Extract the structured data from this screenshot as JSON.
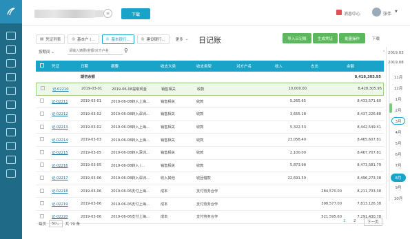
{
  "topbar": {
    "company_dropdown_placeholder": "",
    "top_action_label": "下载",
    "messages_label": "消息中心",
    "user_name": "张伟"
  },
  "tabs": [
    {
      "label": "凭证列表",
      "icon": "doc-icon"
    },
    {
      "label": "基本户 (..."
    },
    {
      "label": "基本银行..."
    },
    {
      "label": "建设银行..."
    },
    {
      "label": "更多"
    }
  ],
  "page": {
    "title": "日记账",
    "buttons": {
      "import": "导入日记账",
      "generate": "生成凭证",
      "more": "批量操作",
      "download": "下载"
    }
  },
  "filter": {
    "period_label": "按期间",
    "search_placeholder": "请输入摘要/金额/对方户名"
  },
  "table": {
    "headers": [
      "凭证",
      "日期",
      "摘要",
      "收支大类",
      "收支类型",
      "对方户名",
      "收入",
      "支出",
      "余额"
    ],
    "opening": {
      "label": "期初余额",
      "balance": "8,418,305.95"
    },
    "rows": [
      [
        "记-02210",
        "2019-03-01",
        "2019-06-08提取现金",
        "销售相关",
        "收款",
        "",
        "10,000.00",
        "",
        "8,428,305.95"
      ],
      [
        "记-02211",
        "2019-03-01",
        "2019-06-08转入上海...",
        "销售相关",
        "收款",
        "",
        "5,265.65",
        "",
        "8,433,571.60"
      ],
      [
        "记-02212",
        "2019-03-02",
        "2019-06-08转入深圳...",
        "销售相关",
        "收款",
        "",
        "3,655.28",
        "",
        "8,437,226.88"
      ],
      [
        "记-02213",
        "2019-03-02",
        "2019-06-08转入上海...",
        "销售相关",
        "收款",
        "",
        "5,322.53",
        "",
        "8,442,549.41"
      ],
      [
        "记-02214",
        "2019-03-03",
        "2019-06-08转入上海...",
        "销售相关",
        "收款",
        "",
        "23,058.40",
        "",
        "8,465,607.81"
      ],
      [
        "记-02215",
        "2019-03-05",
        "2019-06-08转入深圳...",
        "销售相关",
        "收款",
        "",
        "2,100.00",
        "",
        "8,467,707.81"
      ],
      [
        "记-02216",
        "2019-03-05",
        "2019-06-08转入 (...",
        "销售相关",
        "收款",
        "",
        "5,873.98",
        "",
        "8,473,581.79"
      ],
      [
        "记-02217",
        "2019-03-06",
        "2019-06-08转入深圳...",
        "收入其他",
        "收回借款",
        "",
        "22,691.59",
        "",
        "8,496,273.38"
      ],
      [
        "记-02218",
        "2019-03-06",
        "2019-06-06支付上海...",
        "成本",
        "支付劳务合作",
        "",
        "",
        "284,570.00",
        "8,211,703.38"
      ],
      [
        "记-02219",
        "2019-03-06",
        "2019-06-06支付上海...",
        "成本",
        "支付劳务合作",
        "",
        "",
        "398,577.00",
        "7,813,126.38"
      ],
      [
        "记-02220",
        "2019-03-06",
        "2019-06-06支付上海...",
        "成本",
        "支付劳务合作",
        "",
        "",
        "521,595.60",
        "7,291,430.78"
      ]
    ]
  },
  "pager": {
    "per_page_label": "每页",
    "per_page": "50",
    "total": "共 79 条",
    "current": "1",
    "next": "2",
    "next_label": "下一页"
  },
  "year_panel": {
    "year_top": "2019.03",
    "year_bottom": "2019.08",
    "months": [
      "11月",
      "12月",
      "1月",
      "2月",
      "3月",
      "4月",
      "5月",
      "6月",
      "7月",
      "8月",
      "9月",
      "10月"
    ],
    "active_month": "8月",
    "ring_month": "3月"
  },
  "colors": {
    "accent": "#1aa3c9",
    "green": "#5cb85c",
    "rail": "#1f6b87"
  }
}
